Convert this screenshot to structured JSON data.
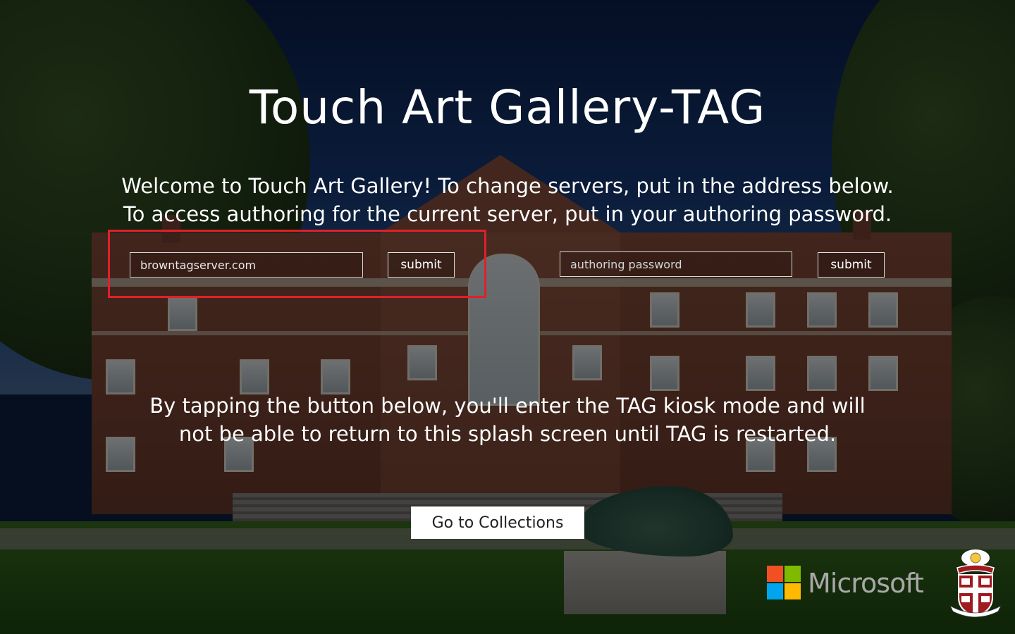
{
  "app": {
    "title": "Touch Art Gallery-TAG",
    "welcome_line1": "Welcome to Touch Art Gallery! To change servers, put in the address below.",
    "welcome_line2": "To access authoring for the current server, put in your authoring password."
  },
  "server": {
    "value": "browntagserver.com",
    "submit_label": "submit"
  },
  "authoring": {
    "placeholder": "authoring password",
    "value": "",
    "submit_label": "submit"
  },
  "kiosk": {
    "line1": "By tapping the button below, you'll enter the TAG kiosk mode and will",
    "line2": "not be able to return to this splash screen until TAG is restarted.",
    "button_label": "Go to Collections"
  },
  "footer": {
    "microsoft_label": "Microsoft",
    "seal_motto": "IN DEO SPERAMUS"
  },
  "colors": {
    "highlight_border": "#e0202a",
    "text": "#ffffff",
    "ms_red": "#f25022",
    "ms_green": "#7fba00",
    "ms_blue": "#00a4ef",
    "ms_yellow": "#ffb900"
  },
  "icons": {
    "microsoft": "microsoft-logo-icon",
    "seal": "university-seal-icon"
  }
}
